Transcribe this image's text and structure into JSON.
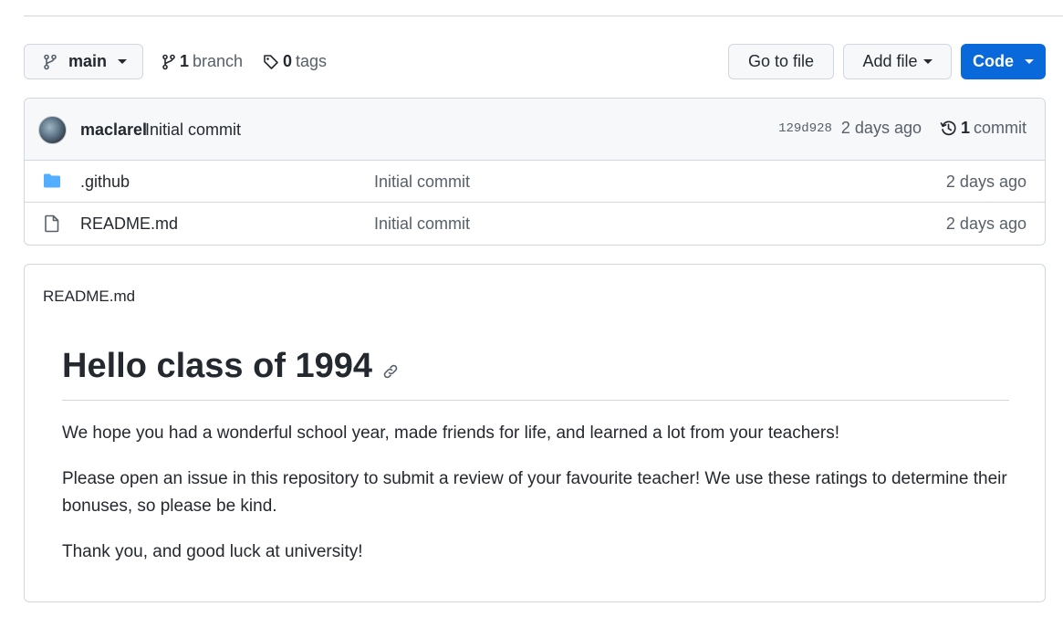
{
  "toolbar": {
    "branch_button": {
      "label": "main",
      "icon": "git-branch-icon"
    },
    "branches": {
      "count": "1",
      "label": "branch"
    },
    "tags": {
      "count": "0",
      "label": "tags"
    },
    "go_to_file_label": "Go to file",
    "add_file_label": "Add file",
    "code_label": "Code",
    "code_color": "#0969da"
  },
  "latest_commit": {
    "author": "maclarel",
    "message": "Initial commit",
    "sha": "129d928",
    "age": "2 days ago",
    "count": "1",
    "count_label": "commit"
  },
  "files": [
    {
      "icon": "folder-icon",
      "name": ".github",
      "commit_message": "Initial commit",
      "age": "2 days ago"
    },
    {
      "icon": "file-icon",
      "name": "README.md",
      "commit_message": "Initial commit",
      "age": "2 days ago"
    }
  ],
  "readme": {
    "filename": "README.md",
    "heading": "Hello class of 1994",
    "paragraphs": [
      "We hope you had a wonderful school year, made friends for life, and learned a lot from your teachers!",
      "Please open an issue in this repository to submit a review of your favourite teacher! We use these ratings to determine their bonuses, so please be kind.",
      "Thank you, and good luck at university!"
    ]
  }
}
